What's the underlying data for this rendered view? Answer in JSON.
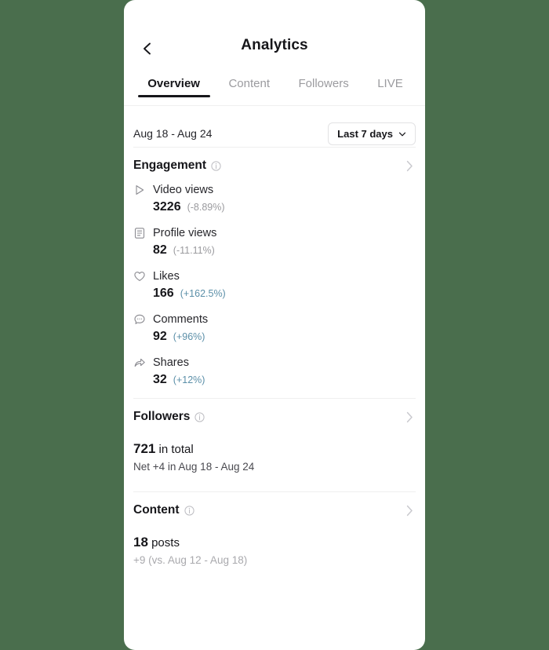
{
  "theme": {
    "background": "#4a6e4d",
    "card": "#ffffff",
    "accent_positive": "#5b8fa8",
    "muted": "#9a9a9e",
    "text": "#16161a"
  },
  "header": {
    "back_icon": "chevron-left-icon",
    "title": "Analytics"
  },
  "tabs": [
    {
      "label": "Overview",
      "active": true
    },
    {
      "label": "Content",
      "active": false
    },
    {
      "label": "Followers",
      "active": false
    },
    {
      "label": "LIVE",
      "active": false
    }
  ],
  "date_bar": {
    "range": "Aug 18 - Aug 24",
    "picker_label": "Last 7 days",
    "picker_icon": "chevron-down-icon"
  },
  "sections": {
    "engagement": {
      "title": "Engagement",
      "info_icon": "info-icon",
      "chevron_icon": "chevron-right-icon",
      "metrics": [
        {
          "icon": "play-icon",
          "name": "Video views",
          "value": "3226",
          "change": "(-8.89%)",
          "direction": "down"
        },
        {
          "icon": "profile-card-icon",
          "name": "Profile views",
          "value": "82",
          "change": "(-11.11%)",
          "direction": "down"
        },
        {
          "icon": "heart-icon",
          "name": "Likes",
          "value": "166",
          "change": "(+162.5%)",
          "direction": "up"
        },
        {
          "icon": "comment-icon",
          "name": "Comments",
          "value": "92",
          "change": "(+96%)",
          "direction": "up"
        },
        {
          "icon": "share-icon",
          "name": "Shares",
          "value": "32",
          "change": "(+12%)",
          "direction": "up"
        }
      ]
    },
    "followers": {
      "title": "Followers",
      "info_icon": "info-icon",
      "chevron_icon": "chevron-right-icon",
      "total_value": "721",
      "total_suffix": " in total",
      "net_text": "Net +4 in Aug 18 - Aug 24"
    },
    "content": {
      "title": "Content",
      "info_icon": "info-icon",
      "chevron_icon": "chevron-right-icon",
      "posts_value": "18",
      "posts_suffix": " posts",
      "comparison_text": "+9 (vs. Aug 12 - Aug 18)"
    }
  }
}
